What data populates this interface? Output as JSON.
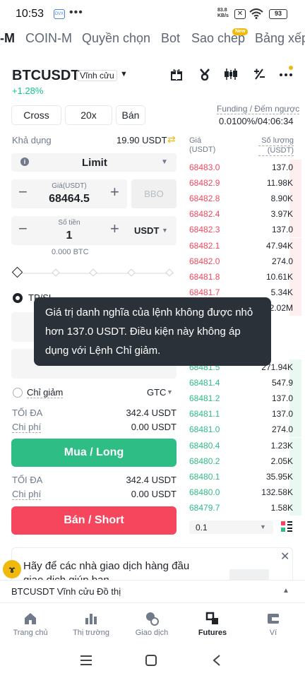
{
  "status_bar": {
    "time": "10:53",
    "app_badge": "DVX",
    "dots": "•••",
    "net_speed_top": "83.8",
    "net_speed_unit": "KB/s",
    "battery": "93"
  },
  "tabs": [
    "-M",
    "COIN-M",
    "Quyền chọn",
    "Bot",
    "Sao chép",
    "Bảng xếp"
  ],
  "new_badge": "New",
  "symbol": {
    "name": "BTCUSDT",
    "type": "Vĩnh cửu",
    "change": "+1.28%"
  },
  "settings": {
    "margin": "Cross",
    "leverage": "20x",
    "side": "Bán"
  },
  "funding": {
    "label": "Funding / Đếm ngược",
    "value": "0.0100%/04:06:34"
  },
  "available": {
    "label": "Khả dụng",
    "value": "19.90 USDT"
  },
  "orderbook_header": {
    "price": "Giá\n(USDT)",
    "price_l1": "Giá",
    "price_l2": "(USDT)",
    "qty_l1": "Số lượng",
    "qty_l2": "(USDT)"
  },
  "order_type": "Limit",
  "price_field": {
    "label": "Giá(USDT)",
    "value": "68464.5",
    "bbo": "BBO"
  },
  "amount_field": {
    "label": "Số tiền",
    "value": "1",
    "unit": "USDT"
  },
  "btc_amount": "0.000 BTC",
  "tpsl": "TP/SL",
  "reduce_only": "Chỉ giảm",
  "tif": "GTC",
  "buy_block": {
    "max_label": "TỐI ĐA",
    "max_value": "342.4 USDT",
    "cost_label": "Chi phí",
    "cost_value": "0.00 USDT",
    "button": "Mua / Long"
  },
  "sell_block": {
    "max_label": "TỐI ĐA",
    "max_value": "342.4 USDT",
    "cost_label": "Chi phí",
    "cost_value": "0.00 USDT",
    "button": "Bán / Short"
  },
  "asks": [
    {
      "price": "68483.0",
      "qty": "137.0",
      "depth": 0.1
    },
    {
      "price": "68482.9",
      "qty": "11.98K",
      "depth": 0.1
    },
    {
      "price": "68482.8",
      "qty": "8.90K",
      "depth": 0.1
    },
    {
      "price": "68482.4",
      "qty": "3.97K",
      "depth": 0.1
    },
    {
      "price": "68482.3",
      "qty": "137.0",
      "depth": 0.1
    },
    {
      "price": "68482.1",
      "qty": "47.94K",
      "depth": 0.1
    },
    {
      "price": "68482.0",
      "qty": "274.0",
      "depth": 0.1
    },
    {
      "price": "68481.8",
      "qty": "10.61K",
      "depth": 0.1
    },
    {
      "price": "68481.7",
      "qty": "5.34K",
      "depth": 0.1
    },
    {
      "price": "",
      "qty": "2.02M",
      "depth": 0.1
    }
  ],
  "bids": [
    {
      "price": "68481.5",
      "qty": "271.94K",
      "depth": 0.1
    },
    {
      "price": "68481.4",
      "qty": "547.9",
      "depth": 0.1
    },
    {
      "price": "68481.2",
      "qty": "137.0",
      "depth": 0.1
    },
    {
      "price": "68481.1",
      "qty": "137.0",
      "depth": 0.1
    },
    {
      "price": "68481.0",
      "qty": "274.0",
      "depth": 0.1
    },
    {
      "price": "68480.4",
      "qty": "1.23K",
      "depth": 0.1
    },
    {
      "price": "68480.2",
      "qty": "2.05K",
      "depth": 0.1
    },
    {
      "price": "68480.1",
      "qty": "35.95K",
      "depth": 0.1
    },
    {
      "price": "68480.0",
      "qty": "132.58K",
      "depth": 0.1
    },
    {
      "price": "68479.7",
      "qty": "1.58K",
      "depth": 0.1
    }
  ],
  "precision": "0.1",
  "tooltip": "Giá trị danh nghĩa của lệnh không được nhỏ hơn 137.0 USDT. Điều kiện này không áp dụng với Lệnh Chỉ giảm.",
  "banner": {
    "text": "Hãy để các nhà giao dịch hàng đầu giao dịch giúp bạn"
  },
  "chart_bar": "BTCUSDT Vĩnh cửu Đồ thị",
  "nav": [
    "Trang chủ",
    "Thị trường",
    "Giao dịch",
    "Futures",
    "Ví"
  ],
  "colors": {
    "buy": "#2ebd85",
    "sell": "#f6465d",
    "accent": "#f0b90b"
  }
}
